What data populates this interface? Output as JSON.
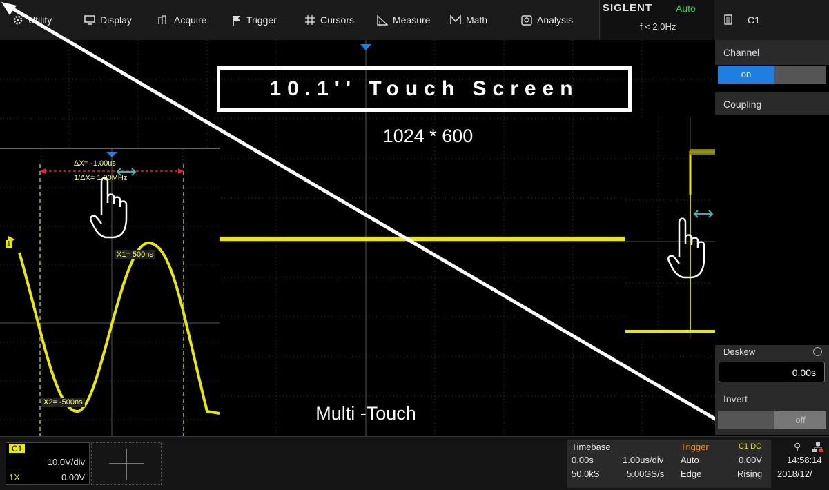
{
  "menu": [
    {
      "label": "Utility",
      "icon": "gear-icon"
    },
    {
      "label": "Display",
      "icon": "display-icon"
    },
    {
      "label": "Acquire",
      "icon": "acquire-icon"
    },
    {
      "label": "Trigger",
      "icon": "flag-icon"
    },
    {
      "label": "Cursors",
      "icon": "cursors-icon"
    },
    {
      "label": "Measure",
      "icon": "measure-icon"
    },
    {
      "label": "Math",
      "icon": "math-icon"
    },
    {
      "label": "Analysis",
      "icon": "analysis-icon"
    }
  ],
  "brand": {
    "name": "SIGLENT",
    "mode": "Auto",
    "freq": "f < 2.0Hz"
  },
  "channel_header": {
    "label": "C1",
    "icon": "document-icon"
  },
  "panel": {
    "channel_label": "Channel",
    "channel_on": "on",
    "coupling_label": "Coupling",
    "deskew_label": "Deskew",
    "deskew_value": "0.00s",
    "invert_label": "Invert",
    "invert_value": "off"
  },
  "overlay": {
    "title": "10.1'' Touch Screen",
    "resolution": "1024 * 600",
    "multitouch": "Multi -Touch"
  },
  "cursors": {
    "delta_x": "ΔX= -1.00us",
    "inv_delta_x": "1/ΔX= 1.00MHz",
    "x1": "X1= 500ns",
    "x2": "X2= -500ns",
    "channel_marker": "1"
  },
  "bottom": {
    "channel_badge": "C1",
    "volts_div": "10.0V/div",
    "probe": "1X",
    "offset": "0.00V",
    "timebase_label": "Timebase",
    "tb_delay": "0.00s",
    "tb_scale": "1.00us/div",
    "tb_mode": "Auto",
    "tb_points": "50.0kS",
    "tb_rate": "5.00GS/s",
    "tb_type": "Edge",
    "trigger_label": "Trigger",
    "trig_source": "C1 DC",
    "trig_level": "0.00V",
    "trig_slope": "Rising",
    "time": "14:58:14",
    "date": "2018/12/"
  },
  "colors": {
    "trace": "#ffff00",
    "accent": "#1e7fe0",
    "brand_green": "#39d04f"
  }
}
